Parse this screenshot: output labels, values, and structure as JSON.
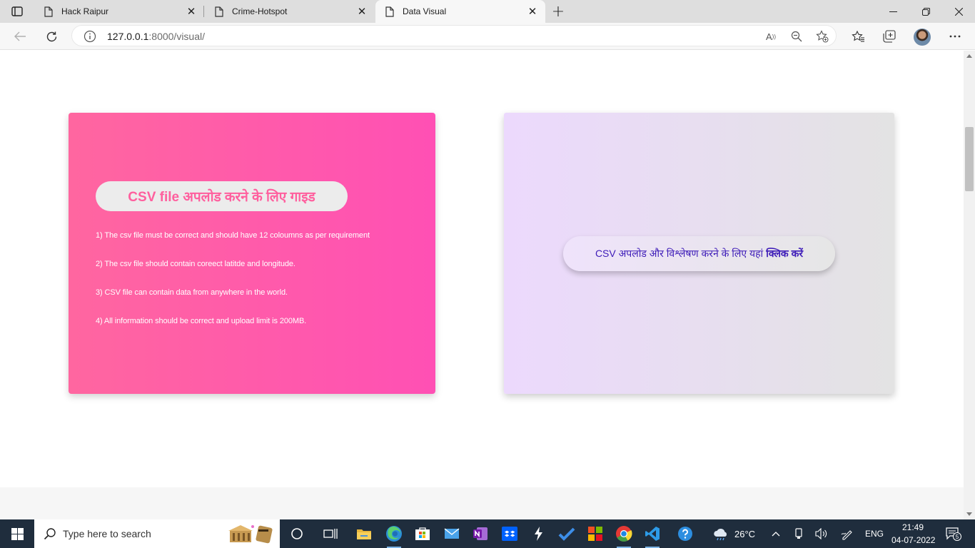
{
  "browser": {
    "tabs": [
      {
        "title": "Hack Raipur",
        "active": false
      },
      {
        "title": "Crime-Hotspot",
        "active": false
      },
      {
        "title": "Data Visual",
        "active": true
      }
    ],
    "address": {
      "host": "127.0.0.1",
      "path": ":8000/visual/"
    }
  },
  "page": {
    "guide": {
      "title": "CSV file अपलोड करने के लिए गाइड",
      "items": [
        "1) The csv file must be correct and should have 12 coloumns as per requirement",
        "2) The csv file should contain coreect latitde and longitude.",
        "3) CSV file can contain data from anywhere in the world.",
        "4) All information should be correct and upload limit is 200MB."
      ],
      "accent": "#ff5fa5"
    },
    "upload": {
      "label": "CSV अपलोड और विश्लेषण करने के लिए यहां",
      "link": "क्लिक करें",
      "text_color": "#3d1bb8"
    }
  },
  "taskbar": {
    "search_placeholder": "Type here to search",
    "weather": "26°C",
    "language": "ENG",
    "time": "21:49",
    "date": "04-07-2022",
    "notifications": "5"
  },
  "icons": {
    "tab_actions": "tab-actions-icon",
    "page": "page-icon",
    "back": "back-arrow-icon",
    "refresh": "refresh-icon",
    "info": "info-icon",
    "read_aloud": "read-aloud-icon",
    "zoom_out": "zoom-out-icon",
    "favorite_add": "add-favorite-icon",
    "favorites": "favorites-icon",
    "collections": "collections-icon",
    "more": "more-icon"
  }
}
